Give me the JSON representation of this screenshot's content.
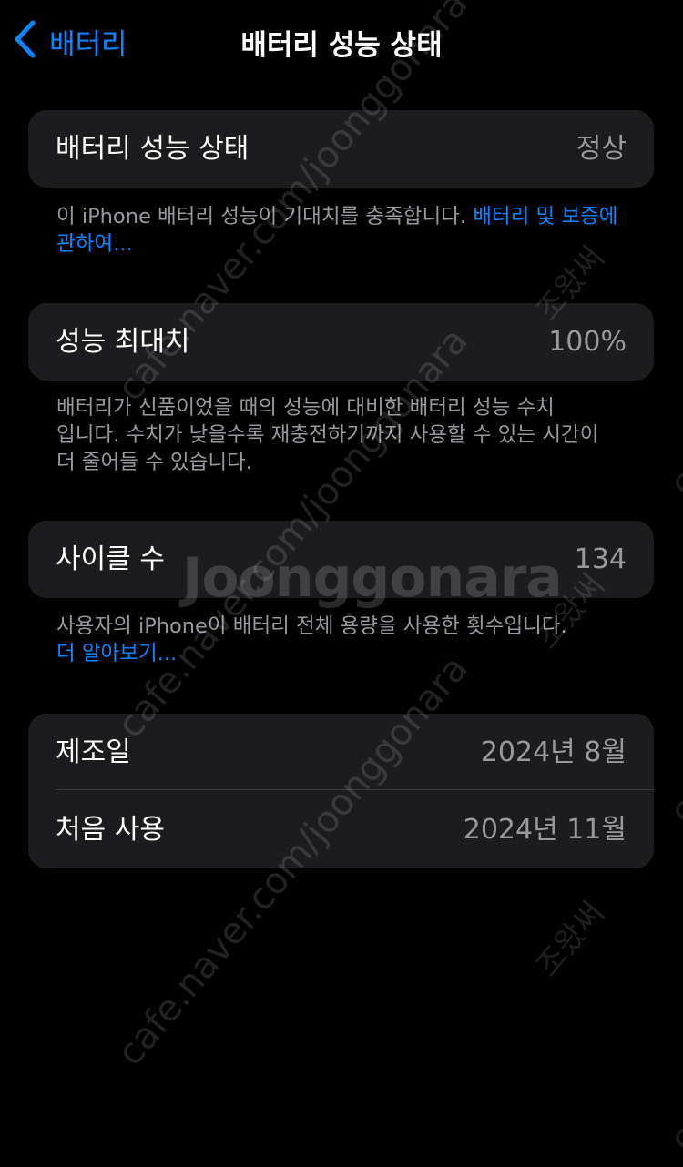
{
  "nav": {
    "back_label": "배터리",
    "title": "배터리 성능 상태"
  },
  "health": {
    "label": "배터리 성능 상태",
    "value": "정상",
    "note": "이 iPhone 배터리 성능이 기대치를 충족합니다.",
    "note_link": "배터리 및 보증에 관하여..."
  },
  "max_capacity": {
    "label": "성능 최대치",
    "value": "100%",
    "note_line1": "배터리가 신품이었을 때의 성능에 대비한 배터리 성능 수치",
    "note_line2": "입니다. 수치가 낮을수록 재충전하기까지 사용할 수 있는 시간이",
    "note_line3": "더 줄어들 수 있습니다."
  },
  "cycle": {
    "label": "사이클 수",
    "value": "134",
    "note": "사용자의 iPhone이 배터리 전체 용량을 사용한 횟수입니다.",
    "note_link": "더 알아보기..."
  },
  "dates": {
    "manufacture_label": "제조일",
    "manufacture_value": "2024년 8월",
    "first_use_label": "처음 사용",
    "first_use_value": "2024년 11월"
  },
  "watermarks": {
    "url": "cafe.naver.com/joonggonara",
    "brand": "Joonggonara",
    "user": "조왔써",
    "edge": "cafe"
  },
  "colors": {
    "background": "#000000",
    "card": "#1c1c1e",
    "accent": "#0a84ff",
    "secondary_text": "#98989f"
  },
  "icons": {
    "back": "chevron-left-icon"
  }
}
